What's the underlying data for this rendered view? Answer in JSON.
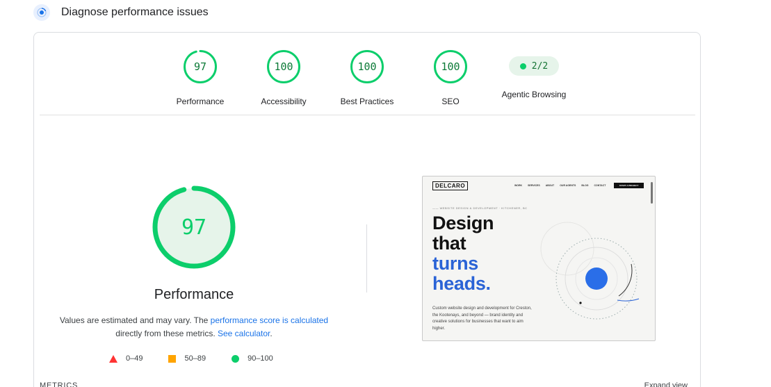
{
  "header": {
    "title": "Diagnose performance issues",
    "icon": "lighthouse-icon",
    "accent": "#1a73e8"
  },
  "categories": [
    {
      "label": "Performance",
      "score": "97",
      "fraction": 0.97
    },
    {
      "label": "Accessibility",
      "score": "100",
      "fraction": 1.0
    },
    {
      "label": "Best Practices",
      "score": "100",
      "fraction": 1.0
    },
    {
      "label": "SEO",
      "score": "100",
      "fraction": 1.0
    }
  ],
  "agentic": {
    "label": "Agentic Browsing",
    "value": "2/2"
  },
  "main": {
    "score": "97",
    "fraction": 0.97,
    "label": "Performance",
    "note_prefix": "Values are estimated and may vary. The ",
    "note_link1": "performance score is calculated",
    "note_middle": " directly from these metrics. ",
    "note_link2": "See calculator",
    "note_suffix": "."
  },
  "legend": [
    {
      "shape": "triangle",
      "range": "0–49",
      "color": "#ff3333"
    },
    {
      "shape": "square",
      "range": "50–89",
      "color": "#ffa400"
    },
    {
      "shape": "circle",
      "range": "90–100",
      "color": "#0cce6b"
    }
  ],
  "metrics_heading": "METRICS",
  "expand_view": "Expand view",
  "colors": {
    "pass": "#0cce6b",
    "pass_bg": "#e6f4ea",
    "pass_text": "#0c7a37"
  },
  "screenshot": {
    "logo": "DELCARO",
    "nav_links": [
      "WORK",
      "SERVICES",
      "ABOUT",
      "OUR AGENTS",
      "BLOG",
      "CONTACT"
    ],
    "cta": "START A PROJECT",
    "kicker": "—— WEBSITE DESIGN & DEVELOPMENT · KITCHENER, BC",
    "headline_1": "Design",
    "headline_2": "that",
    "headline_3": "turns",
    "headline_4": "heads.",
    "body": "Custom website design and development for Creston, the Kootenays, and beyond — brand identity and creative solutions for businesses that want to aim higher."
  }
}
